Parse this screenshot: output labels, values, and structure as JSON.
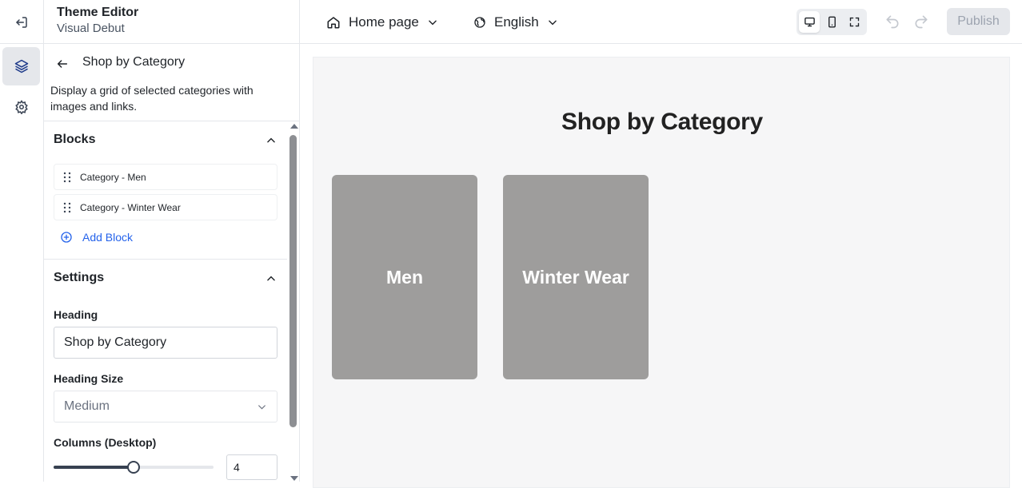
{
  "app": {
    "title": "Theme Editor",
    "theme_name": "Visual Debut",
    "exit_icon": "exit-icon"
  },
  "toolbar": {
    "page_select": {
      "icon": "home-icon",
      "value": "Home page"
    },
    "language_select": {
      "icon": "globe-icon",
      "value": "English"
    },
    "device_modes": [
      {
        "icon": "desktop-icon",
        "active": true
      },
      {
        "icon": "mobile-icon",
        "active": false
      },
      {
        "icon": "fullscreen-icon",
        "active": false
      }
    ],
    "undo_icon": "undo-icon",
    "redo_icon": "redo-icon",
    "publish_label": "Publish"
  },
  "rail": {
    "items": [
      {
        "icon": "layers-icon",
        "active": true
      },
      {
        "icon": "gear-icon",
        "active": false
      }
    ]
  },
  "panel": {
    "title": "Shop by Category",
    "description": "Display a grid of selected categories with images and links.",
    "blocks": {
      "title": "Blocks",
      "items": [
        "Category - Men",
        "Category - Winter Wear"
      ],
      "add_label": "Add Block"
    },
    "settings": {
      "title": "Settings",
      "heading_label": "Heading",
      "heading_value": "Shop by Category",
      "heading_size_label": "Heading Size",
      "heading_size_value": "Medium",
      "columns_label": "Columns (Desktop)",
      "columns_value": "4",
      "columns_fraction": 0.5
    }
  },
  "preview": {
    "heading": "Shop by Category",
    "cards": [
      "Men",
      "Winter Wear"
    ],
    "card_color": "#9e9d9c"
  },
  "colors": {
    "accent": "#2563eb",
    "publish_disabled_bg": "#e5e7eb",
    "publish_disabled_text": "#9ca3af"
  }
}
